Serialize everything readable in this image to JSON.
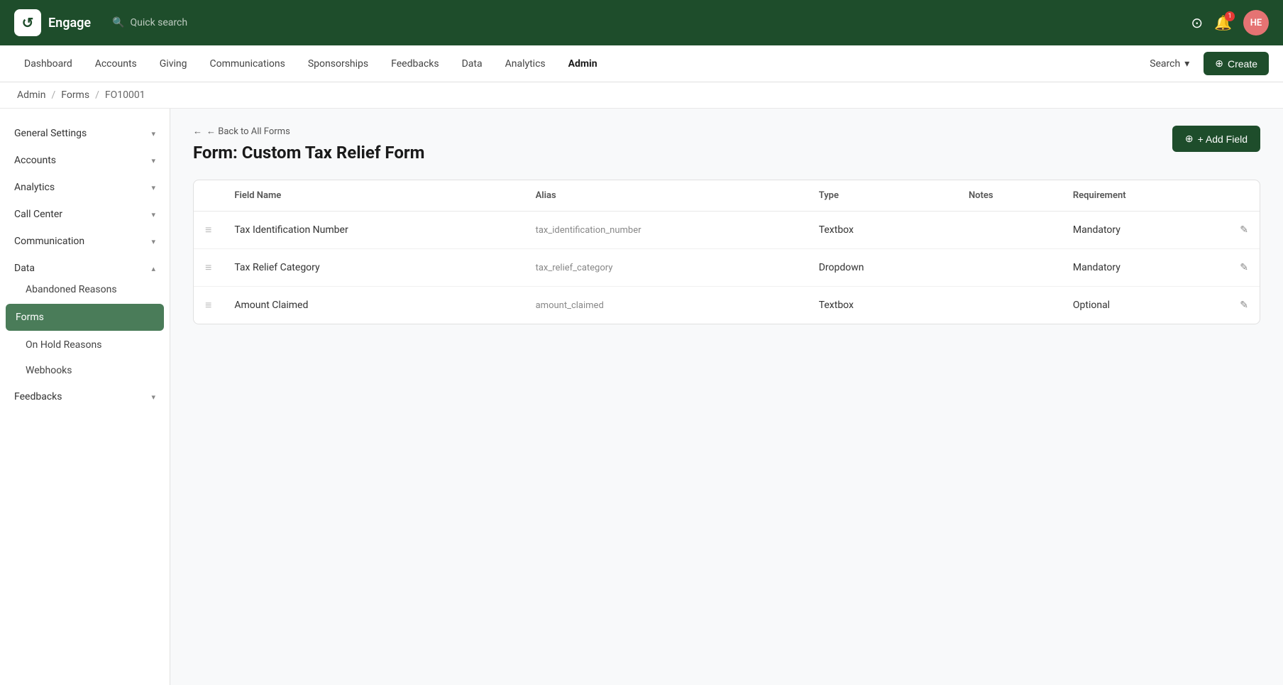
{
  "app": {
    "logo_text": "↺",
    "title": "Engage"
  },
  "topbar": {
    "quick_search_placeholder": "Quick search",
    "help_icon": "?",
    "notification_count": "1",
    "avatar_initials": "HE"
  },
  "nav": {
    "items": [
      {
        "label": "Dashboard",
        "active": false
      },
      {
        "label": "Accounts",
        "active": false
      },
      {
        "label": "Giving",
        "active": false
      },
      {
        "label": "Communications",
        "active": false
      },
      {
        "label": "Sponsorships",
        "active": false
      },
      {
        "label": "Feedbacks",
        "active": false
      },
      {
        "label": "Data",
        "active": false
      },
      {
        "label": "Analytics",
        "active": false
      },
      {
        "label": "Admin",
        "active": true
      }
    ],
    "search_label": "Search",
    "create_label": "Create"
  },
  "breadcrumb": {
    "items": [
      "Admin",
      "Forms",
      "FO10001"
    ]
  },
  "sidebar": {
    "items": [
      {
        "label": "General Settings",
        "has_chevron": true,
        "expanded": false
      },
      {
        "label": "Accounts",
        "has_chevron": true,
        "expanded": false
      },
      {
        "label": "Analytics",
        "has_chevron": true,
        "expanded": false
      },
      {
        "label": "Call Center",
        "has_chevron": true,
        "expanded": false
      },
      {
        "label": "Communication",
        "has_chevron": true,
        "expanded": false
      },
      {
        "label": "Data",
        "has_chevron": true,
        "expanded": true,
        "active_parent": true
      }
    ],
    "data_sub_items": [
      {
        "label": "Abandoned Reasons",
        "active": false
      },
      {
        "label": "Forms",
        "active": true
      },
      {
        "label": "On Hold Reasons",
        "active": false
      },
      {
        "label": "Webhooks",
        "active": false
      }
    ],
    "additional_items": [
      {
        "label": "Feedbacks",
        "has_chevron": true,
        "expanded": false
      }
    ]
  },
  "main": {
    "back_link": "← Back to All Forms",
    "form_title": "Form: Custom Tax Relief Form",
    "add_field_label": "+ Add Field",
    "table": {
      "headers": [
        "",
        "Field Name",
        "Alias",
        "Type",
        "Notes",
        "Requirement",
        ""
      ],
      "rows": [
        {
          "drag": "≡",
          "field_name": "Tax Identification Number",
          "alias": "tax_identification_number",
          "type": "Textbox",
          "notes": "",
          "requirement": "Mandatory",
          "edit_icon": "✎"
        },
        {
          "drag": "≡",
          "field_name": "Tax Relief Category",
          "alias": "tax_relief_category",
          "type": "Dropdown",
          "notes": "",
          "requirement": "Mandatory",
          "edit_icon": "✎"
        },
        {
          "drag": "≡",
          "field_name": "Amount Claimed",
          "alias": "amount_claimed",
          "type": "Textbox",
          "notes": "",
          "requirement": "Optional",
          "edit_icon": "✎"
        }
      ]
    }
  }
}
